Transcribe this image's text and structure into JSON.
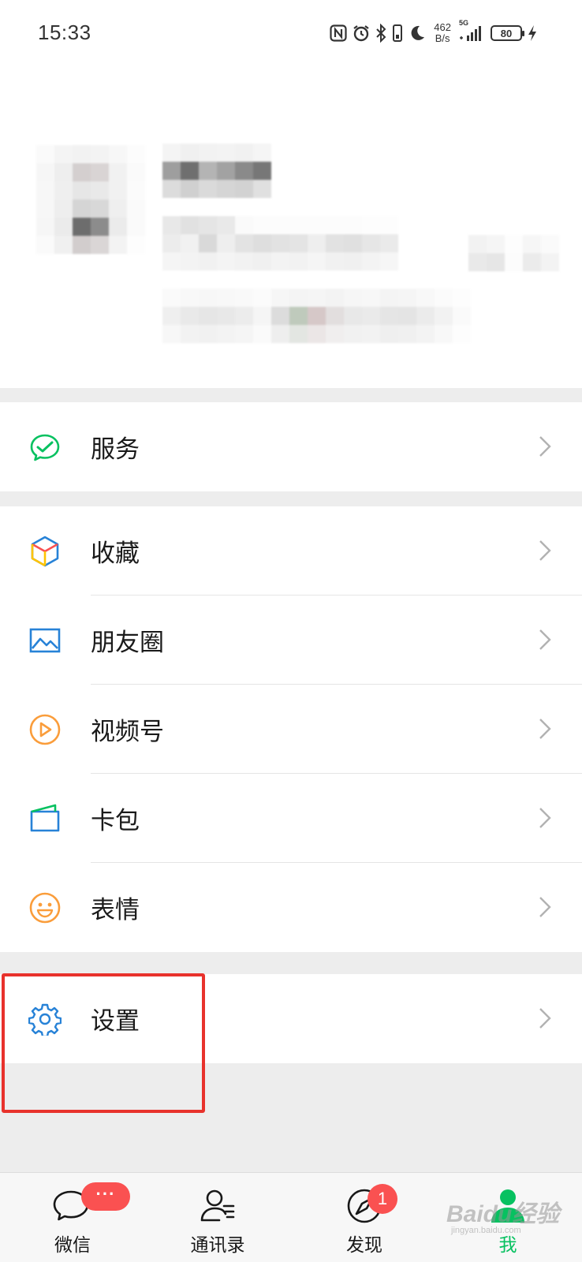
{
  "status_bar": {
    "time": "15:33",
    "net_speed_value": "462",
    "net_speed_unit": "B/s",
    "signal_label": "5G",
    "battery": "80",
    "icons": [
      "nfc-icon",
      "alarm-icon",
      "bluetooth-icon",
      "vibrate-icon",
      "moon-icon",
      "signal-icon",
      "battery-icon",
      "charging-icon"
    ]
  },
  "profile": {
    "avatar": "pixelated-avatar",
    "name": "",
    "wechat_id": ""
  },
  "menu": {
    "services": {
      "label": "服务",
      "icon": "services-icon",
      "color": "#07c160"
    },
    "favorites": {
      "label": "收藏",
      "icon": "cube-icon"
    },
    "moments": {
      "label": "朋友圈",
      "icon": "image-icon",
      "color": "#2782d7"
    },
    "channels": {
      "label": "视频号",
      "icon": "play-circle-icon",
      "color": "#fa9d3b"
    },
    "cards": {
      "label": "卡包",
      "icon": "wallet-icon",
      "color": "#2782d7"
    },
    "stickers": {
      "label": "表情",
      "icon": "smile-icon",
      "color": "#fa9d3b"
    },
    "settings": {
      "label": "设置",
      "icon": "gear-icon",
      "color": "#2782d7"
    }
  },
  "tabbar": {
    "chats": {
      "label": "微信",
      "badge": "···"
    },
    "contacts": {
      "label": "通讯录"
    },
    "discover": {
      "label": "发现",
      "badge": "1"
    },
    "me": {
      "label": "我",
      "active_color": "#07c160"
    }
  },
  "watermark": {
    "main": "Baidu经验",
    "sub": "jingyan.baidu.com"
  },
  "colors": {
    "highlight_box": "#e8322c",
    "badge": "#fa5151",
    "accent": "#07c160",
    "background": "#ededed"
  }
}
